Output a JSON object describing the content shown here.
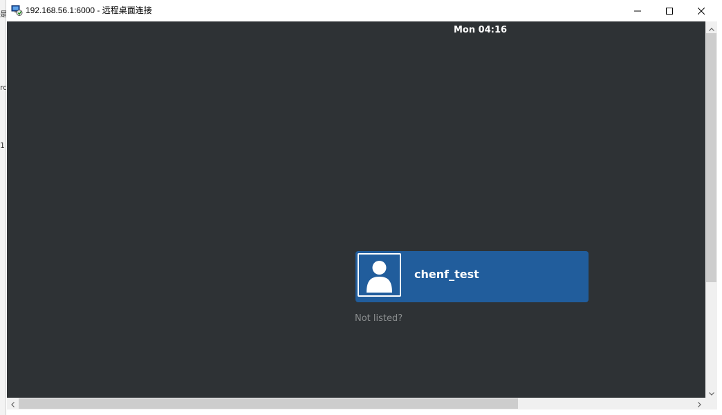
{
  "window": {
    "title": "192.168.56.1:6000 - 远程桌面连接",
    "app_icon": "remote-desktop-icon",
    "minimize_icon": "minimize-icon",
    "maximize_icon": "maximize-icon",
    "close_icon": "close-icon"
  },
  "background_desktop": {
    "glyphs": [
      "是",
      "ro",
      "1"
    ]
  },
  "top_bar": {
    "clock": "Mon 04:16"
  },
  "login": {
    "user": {
      "name": "chenf_test",
      "avatar_icon": "user-avatar-icon"
    },
    "not_listed_label": "Not listed?"
  },
  "colors": {
    "screen_bg": "#2e3235",
    "user_card_bg": "#215d9c",
    "not_listed_text": "#8b8e8f",
    "scrollbar_track": "#f0f0f0",
    "scrollbar_thumb": "#cdcdcd"
  }
}
